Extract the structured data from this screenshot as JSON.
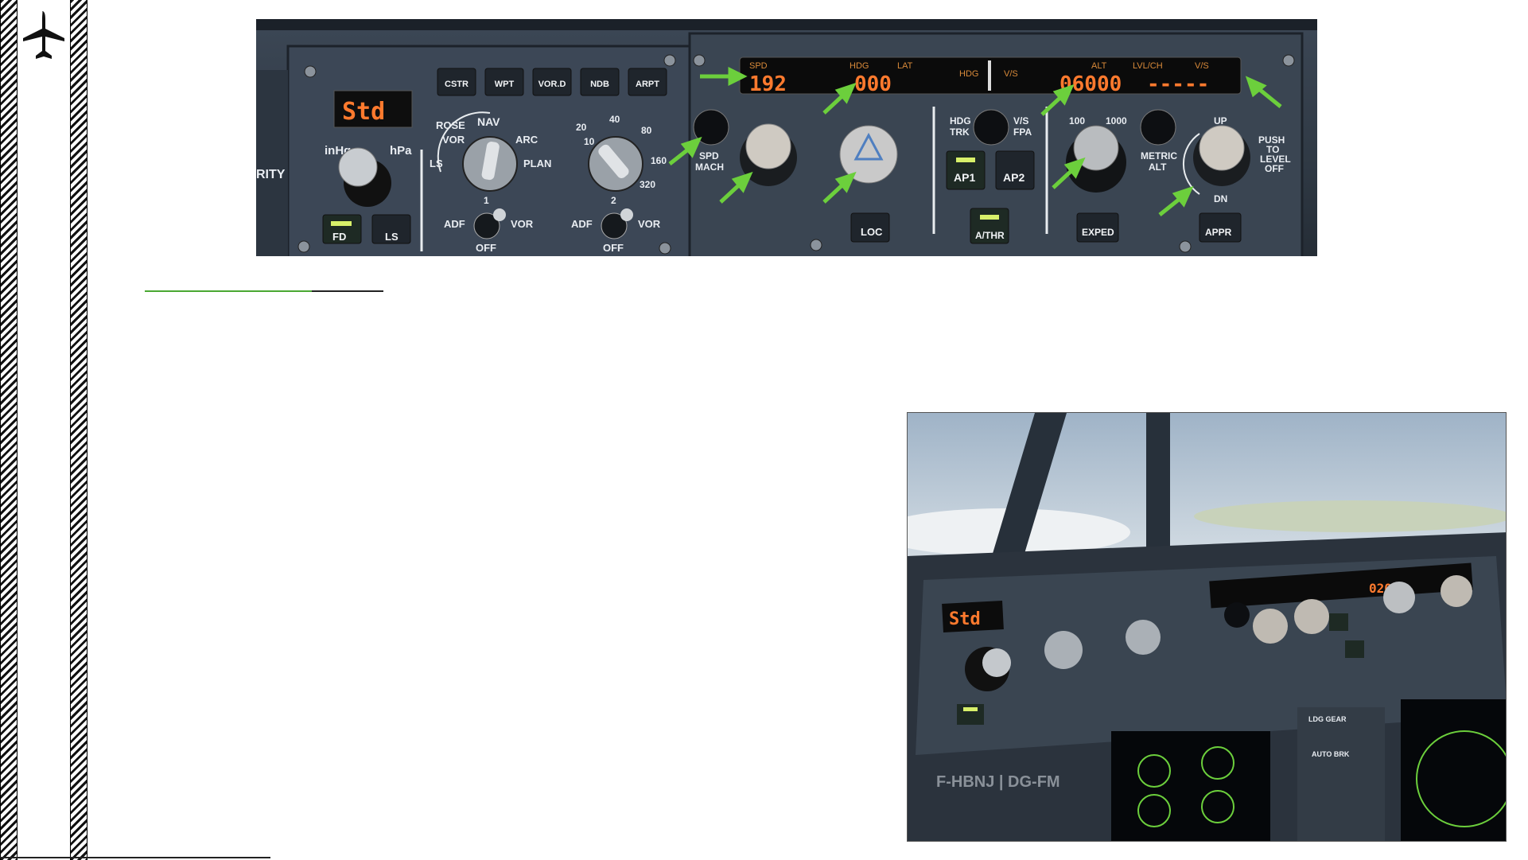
{
  "sidebar": {
    "icon": "airplane-icon"
  },
  "fcu": {
    "efis": {
      "baro_display": "Std",
      "inhg_label": "inHg",
      "hpa_label": "hPa",
      "fd_label": "FD",
      "ls_label": "LS",
      "partial_label": "RITY",
      "buttons": [
        "CSTR",
        "WPT",
        "VOR.D",
        "NDB",
        "ARPT"
      ],
      "mode_labels": [
        "ROSE",
        "VOR",
        "LS",
        "NAV",
        "ARC",
        "PLAN"
      ],
      "range_labels": [
        "10",
        "20",
        "40",
        "80",
        "160",
        "320"
      ],
      "adf1": {
        "num": "1",
        "left": "ADF",
        "right": "VOR",
        "off": "OFF"
      },
      "adf2": {
        "num": "2",
        "left": "ADF",
        "right": "VOR",
        "off": "OFF"
      }
    },
    "display": {
      "spd_label": "SPD",
      "spd_value": "192",
      "hdg_label": "HDG",
      "lat_label": "LAT",
      "hdg_value": "000",
      "hdg2_label": "HDG",
      "vs_label": "V/S",
      "alt_label": "ALT",
      "lvlch_label": "LVL/CH",
      "vs2_label": "V/S",
      "alt_value": "06000",
      "vs_value": "-----"
    },
    "controls": {
      "spd_mach_label": [
        "SPD",
        "MACH"
      ],
      "loc_label": "LOC",
      "hdg_trk_label": [
        "HDG",
        "TRK"
      ],
      "vs_fpa_label": [
        "V/S",
        "FPA"
      ],
      "ap1_label": "AP1",
      "ap2_label": "AP2",
      "athr_label": "A/THR",
      "alt_100": "100",
      "alt_1000": "1000",
      "metric_alt_label": [
        "METRIC",
        "ALT"
      ],
      "up_label": "UP",
      "dn_label": "DN",
      "push_label": [
        "PUSH",
        "TO",
        "LEVEL",
        "OFF"
      ],
      "exped_label": "EXPED",
      "appr_label": "APPR"
    }
  },
  "photo": {
    "baro_display": "Std",
    "alt_value": "02000",
    "registration": "F-HBNJ | DG-FM",
    "ldg_gear_label": "LDG GEAR",
    "auto_brk_label": "AUTO BRK"
  }
}
